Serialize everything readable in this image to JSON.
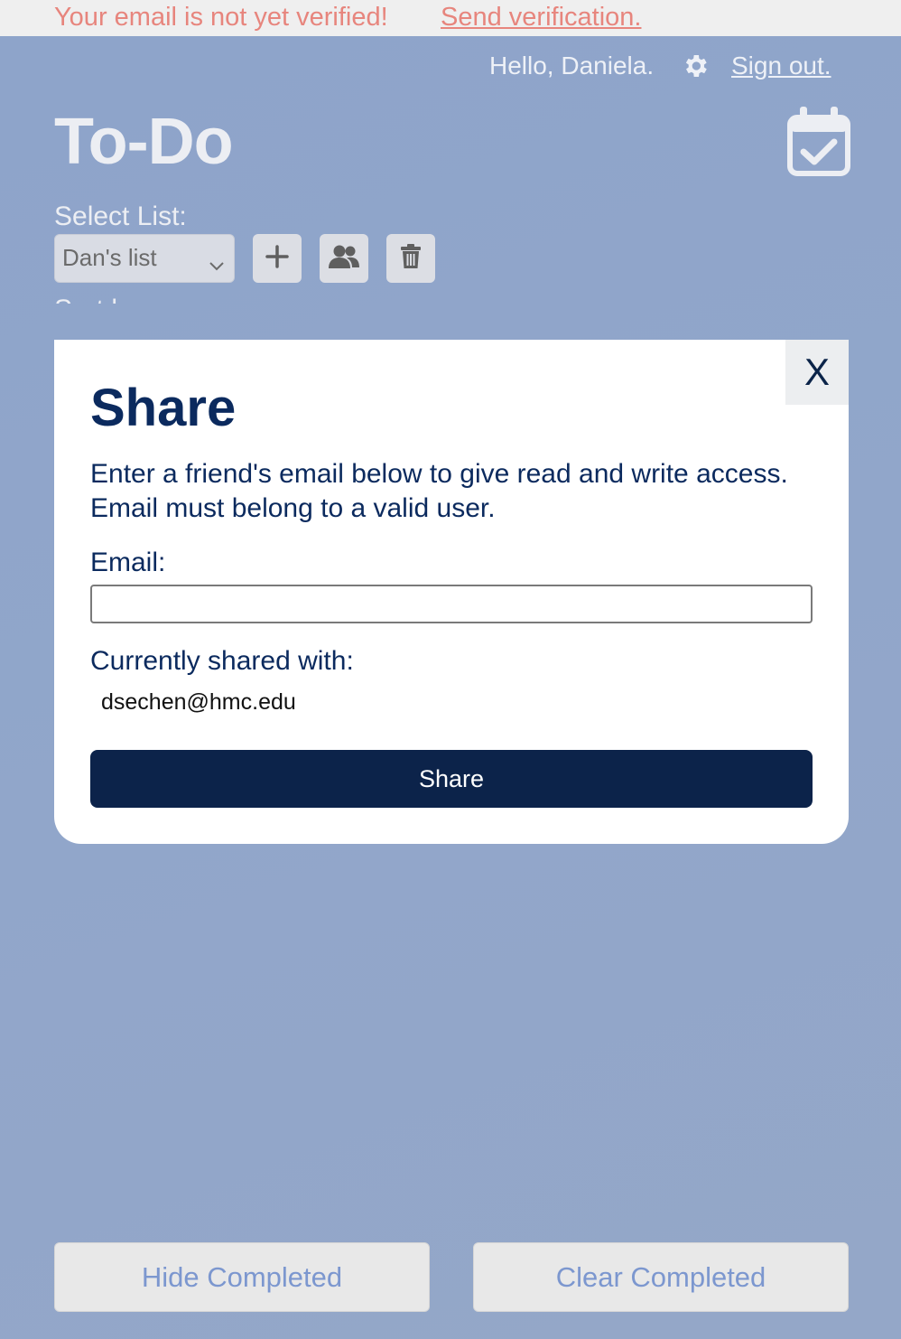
{
  "banner": {
    "message": "Your email is not yet verified!",
    "link_label": "Send verification."
  },
  "header": {
    "greeting": "Hello, Daniela.",
    "settings_icon": "gear-icon",
    "signout_label": "Sign out."
  },
  "app": {
    "title": "To-Do",
    "calendar_icon": "calendar-check-icon"
  },
  "list_controls": {
    "select_label": "Select List:",
    "selected_list": "Dan's list",
    "add_icon": "plus-icon",
    "share_icon": "users-icon",
    "delete_icon": "trash-icon",
    "partially_hidden_text": "Sort by:"
  },
  "share_modal": {
    "close_label": "X",
    "title": "Share",
    "description": "Enter a friend's email below to give read and write access. Email must belong to a valid user.",
    "email_label": "Email:",
    "email_value": "",
    "shared_label": "Currently shared with:",
    "shared_with": [
      "dsechen@hmc.edu"
    ],
    "share_button_label": "Share"
  },
  "footer": {
    "hide_completed_label": "Hide Completed",
    "clear_completed_label": "Clear Completed"
  },
  "colors": {
    "accent": "#0c234a",
    "warning": "#e7857d",
    "background": "#8ea4ca",
    "footer_text": "#7c97cf"
  }
}
